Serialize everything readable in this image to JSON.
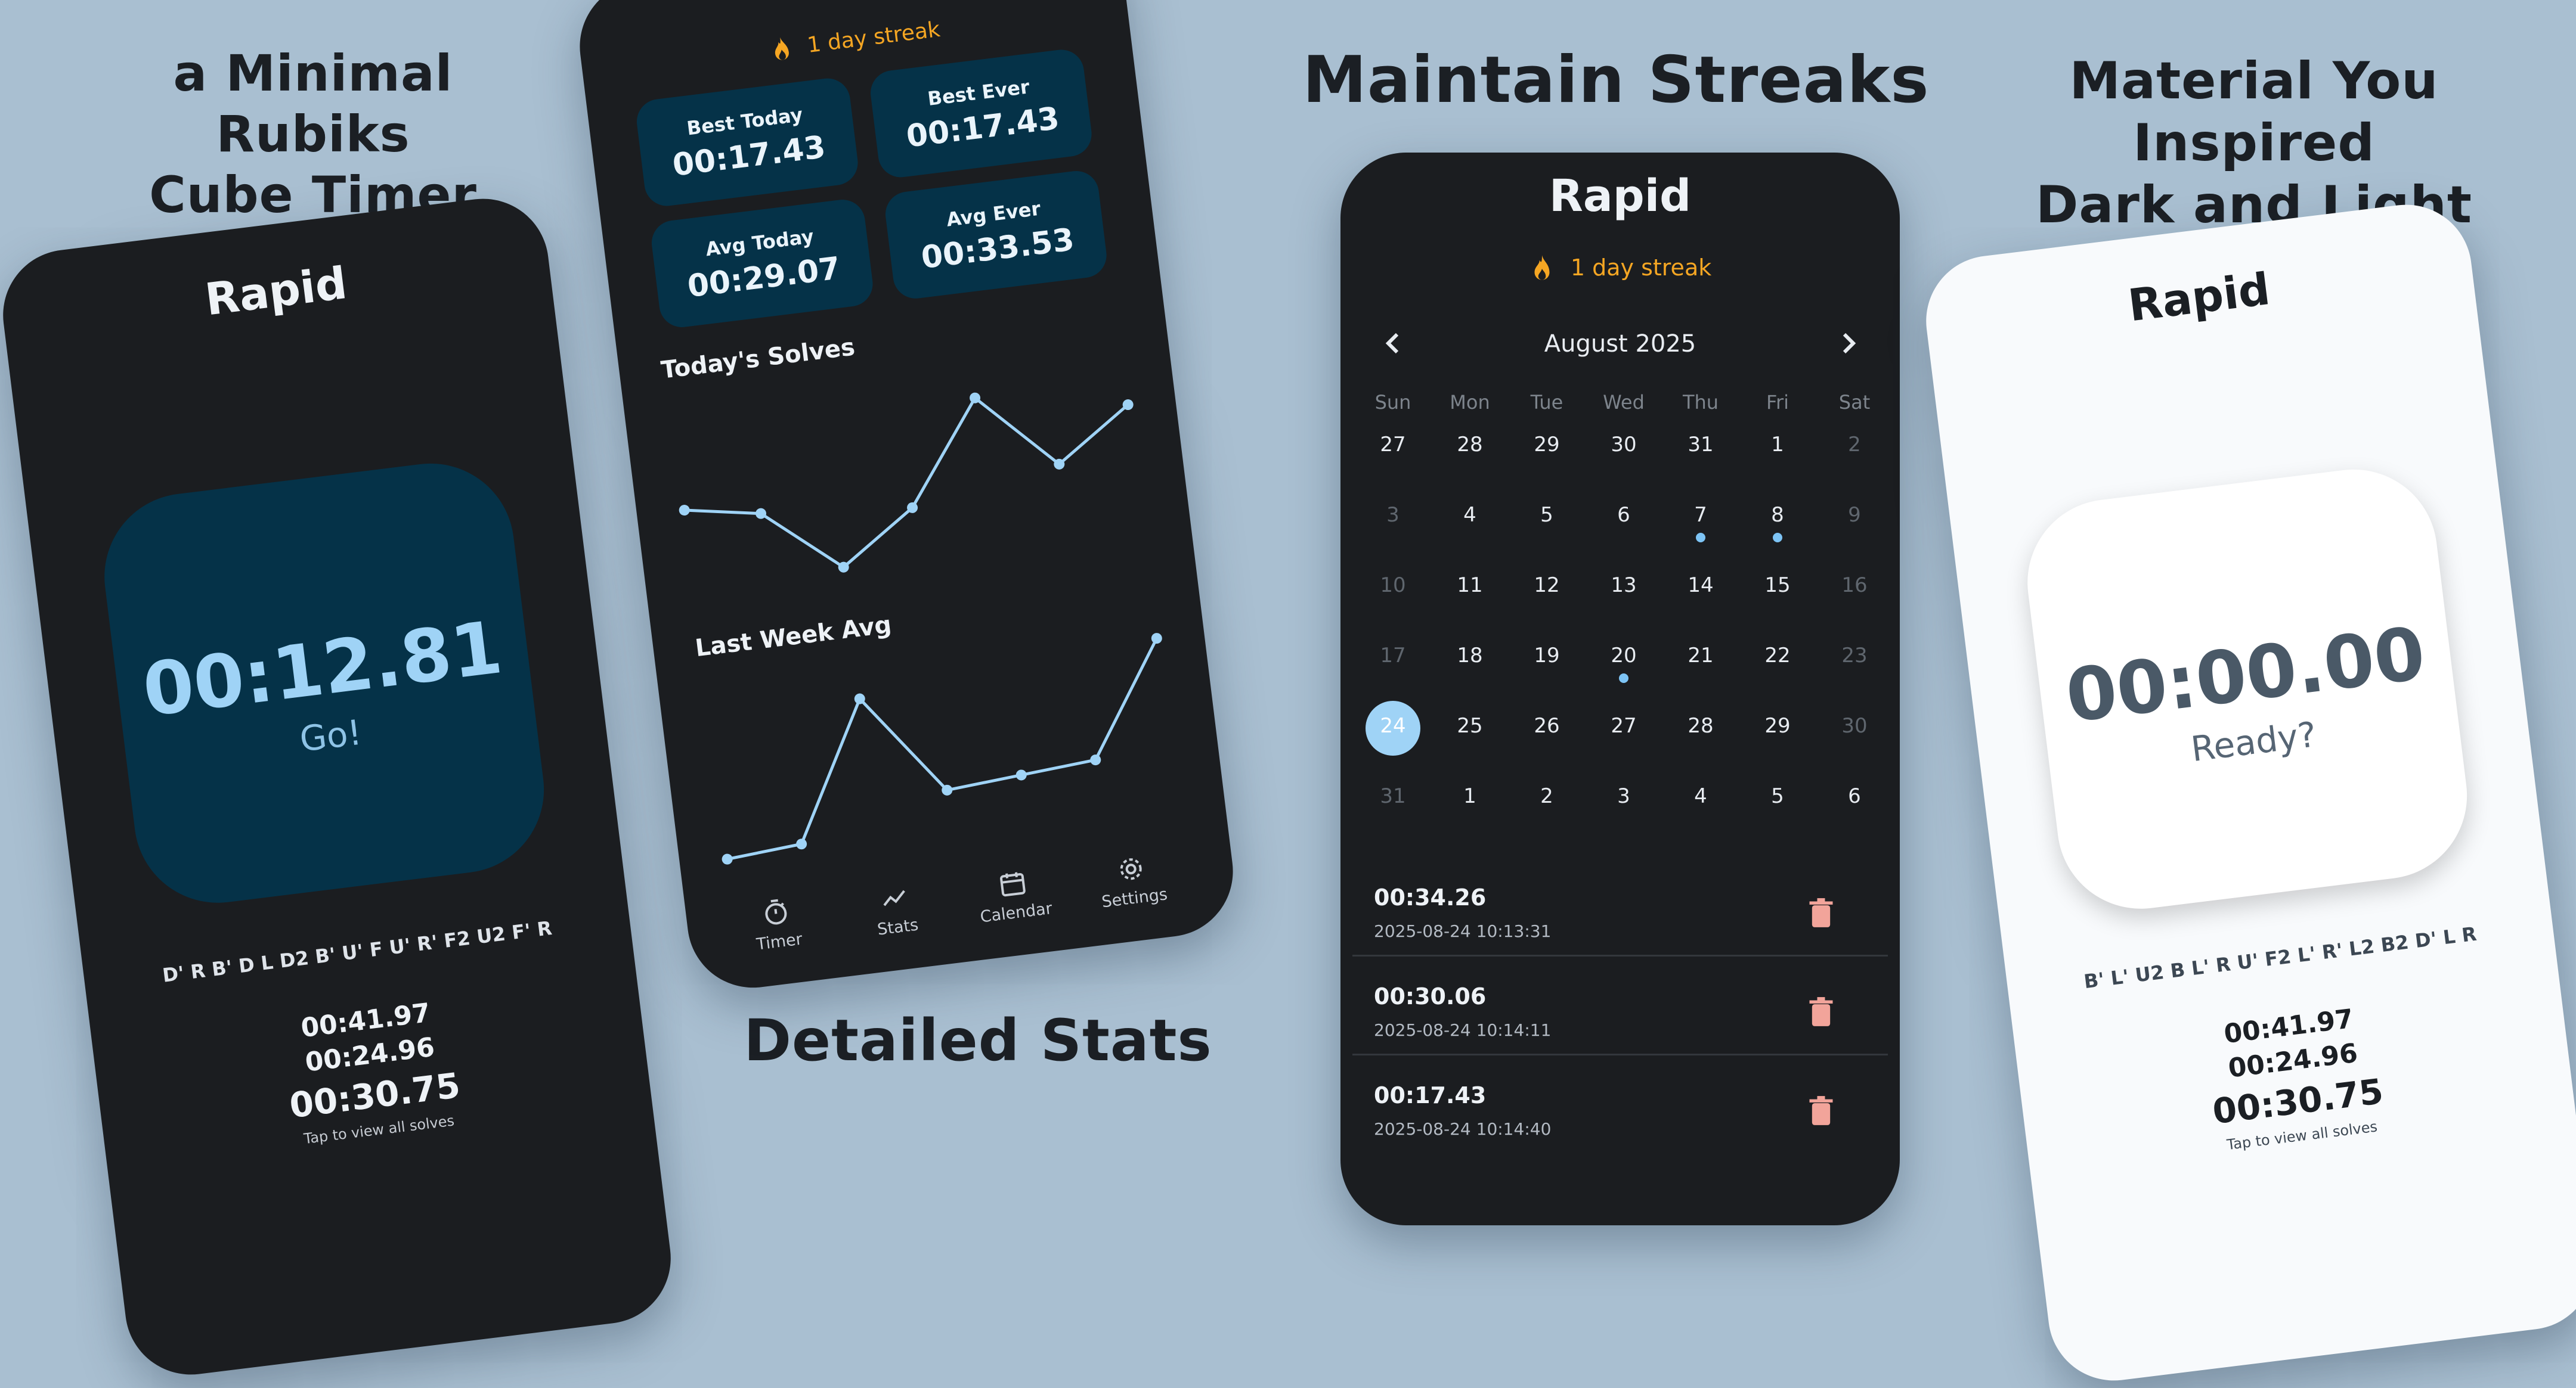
{
  "captions": {
    "timer_line1": "a Minimal Rubiks",
    "timer_line2": "Cube Timer",
    "stats": "Detailed Stats",
    "streaks": "Maintain Streaks",
    "themes_line1": "Material You Inspired",
    "themes_line2": "Dark and Light Themes"
  },
  "timer_screen": {
    "brand": "Rapid",
    "time": "00:12.81",
    "status": "Go!",
    "scramble": "D' R B' D L D2 B' U' F U' R' F2 U2 F' R",
    "recent": [
      "00:41.97",
      "00:24.96",
      "00:30.75"
    ],
    "tap_hint": "Tap to view all solves",
    "colors": {
      "bg": "#1b1d20",
      "tile": "#053248",
      "accent": "#9fd3f6"
    }
  },
  "stats_screen": {
    "streak": "1 day streak",
    "cards": [
      {
        "label": "Best Today",
        "value": "00:17.43"
      },
      {
        "label": "Best Ever",
        "value": "00:17.43"
      },
      {
        "label": "Avg Today",
        "value": "00:29.07"
      },
      {
        "label": "Avg Ever",
        "value": "00:33.53"
      }
    ],
    "chart1_title": "Today's Solves",
    "chart2_title": "Last Week Avg",
    "nav": [
      {
        "label": "Timer",
        "icon": "stopwatch-icon"
      },
      {
        "label": "Stats",
        "icon": "trend-icon"
      },
      {
        "label": "Calendar",
        "icon": "calendar-icon"
      },
      {
        "label": "Settings",
        "icon": "gear-icon"
      }
    ]
  },
  "chart_data": [
    {
      "type": "line",
      "title": "Today's Solves",
      "x": [
        1,
        2,
        3,
        4,
        5,
        6,
        7
      ],
      "series": [
        {
          "values": [
            30,
            29,
            24,
            28,
            36,
            30,
            34
          ]
        }
      ],
      "grid": false
    },
    {
      "type": "line",
      "title": "Last Week Avg",
      "x": [
        1,
        2,
        3,
        4,
        5,
        6,
        7
      ],
      "series": [
        {
          "values": [
            22,
            23,
            46,
            29,
            30,
            31,
            50
          ]
        }
      ],
      "grid": false
    }
  ],
  "calendar_screen": {
    "brand": "Rapid",
    "streak": "1 day streak",
    "month": "August 2025",
    "weekdays": [
      "Sun",
      "Mon",
      "Tue",
      "Wed",
      "Thu",
      "Fri",
      "Sat"
    ],
    "weeks": [
      [
        "27",
        "28",
        "29",
        "30",
        "31",
        "1",
        "2"
      ],
      [
        "3",
        "4",
        "5",
        "6",
        "7",
        "8",
        "9"
      ],
      [
        "10",
        "11",
        "12",
        "13",
        "14",
        "15",
        "16"
      ],
      [
        "17",
        "18",
        "19",
        "20",
        "21",
        "22",
        "23"
      ],
      [
        "24",
        "25",
        "26",
        "27",
        "28",
        "29",
        "30"
      ],
      [
        "31",
        "1",
        "2",
        "3",
        "4",
        "5",
        "6"
      ]
    ],
    "selected_day": "24",
    "solves": [
      {
        "time": "00:34.26",
        "date": "2025-08-24 10:13:31"
      },
      {
        "time": "00:30.06",
        "date": "2025-08-24 10:14:11"
      },
      {
        "time": "00:17.43",
        "date": "2025-08-24 10:14:40"
      }
    ],
    "colors": {
      "streak": "#f5a623",
      "dot": "#7dc4f5",
      "trash": "#f2a49a"
    }
  },
  "light_screen": {
    "brand": "Rapid",
    "time": "00:00.00",
    "status": "Ready?",
    "scramble": "B' L' U2 B L' R U' F2 L' R' L2 B2 D' L R",
    "recent": [
      "00:41.97",
      "00:24.96",
      "00:30.75"
    ],
    "tap_hint": "Tap to view all solves"
  }
}
